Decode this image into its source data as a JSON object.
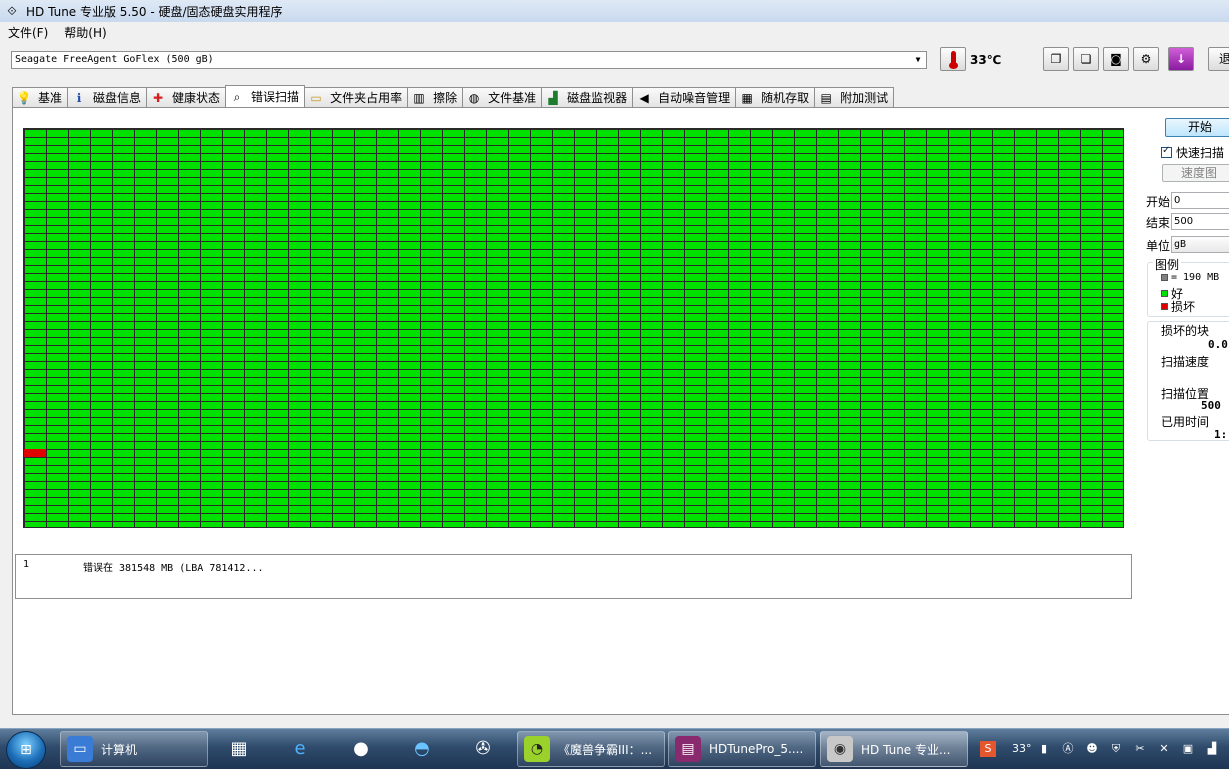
{
  "window": {
    "title": "HD Tune 专业版 5.50 - 硬盘/固态硬盘实用程序"
  },
  "menu": [
    {
      "label": "文件(F)"
    },
    {
      "label": "帮助(H)"
    }
  ],
  "drive": {
    "selected": "Seagate FreeAgent GoFlex (500 gB)"
  },
  "temperature": "33℃",
  "toolbar": {
    "exit_label": "退"
  },
  "icons": {
    "app": "hd-tune-icon",
    "thermometer": "thermometer-icon",
    "copy_text": "copy-text-icon",
    "copy_screen": "copy-screen-icon",
    "camera": "camera-icon",
    "options": "options-icon",
    "save": "download-icon"
  },
  "tabs": [
    {
      "label": "基准",
      "icon": "lightbulb-icon"
    },
    {
      "label": "磁盘信息",
      "icon": "info-icon"
    },
    {
      "label": "健康状态",
      "icon": "health-cross-icon"
    },
    {
      "label": "错误扫描",
      "icon": "magnifier-icon",
      "active": true
    },
    {
      "label": "文件夹占用率",
      "icon": "folder-icon"
    },
    {
      "label": "擦除",
      "icon": "trash-icon"
    },
    {
      "label": "文件基准",
      "icon": "file-bench-icon"
    },
    {
      "label": "磁盘监视器",
      "icon": "monitor-chart-icon"
    },
    {
      "label": "自动噪音管理",
      "icon": "speaker-icon"
    },
    {
      "label": "随机存取",
      "icon": "random-access-icon"
    },
    {
      "label": "附加测试",
      "icon": "extra-tests-icon"
    }
  ],
  "scan_grid": {
    "columns": 50,
    "rows": 50,
    "colors": {
      "good": "#00e100",
      "bad": "#e00000",
      "grid": "#2a2a2a"
    },
    "bad_blocks": [
      {
        "col": 0,
        "row": 40
      }
    ]
  },
  "log": [
    {
      "index": "1",
      "message": "错误在 381548 MB (LBA 781412..."
    }
  ],
  "controls": {
    "start_label": "开始",
    "quick_scan_label": "快速扫描",
    "quick_scan_checked": true,
    "speed_map_label": "速度图",
    "start_field_label": "开始",
    "start_value": "0",
    "end_field_label": "结束",
    "end_value": "500",
    "unit_field_label": "单位",
    "unit_value": "gB"
  },
  "legend": {
    "title": "图例",
    "block_size": "= 190 MB",
    "good_label": "好",
    "bad_label": "损坏",
    "colors": {
      "block": "#808080",
      "good": "#00e100",
      "bad": "#e00000"
    }
  },
  "stats": {
    "damaged_label": "损坏的块",
    "damaged_value": "0.0",
    "speed_label": "扫描速度",
    "position_label": "扫描位置",
    "position_value": "500",
    "elapsed_label": "已用时间",
    "elapsed_value": "1:"
  },
  "taskbar": {
    "items": [
      {
        "label": "计算机",
        "icon": "computer-icon"
      },
      {
        "label": "《魔兽争霸III：...",
        "icon": "pacman-icon"
      },
      {
        "label": "HDTunePro_5....",
        "icon": "winrar-icon"
      },
      {
        "label": "HD Tune 专业...",
        "icon": "hd-tune-icon",
        "active": true
      }
    ],
    "pinned": [
      "calculator-icon",
      "ie-icon",
      "qq-icon",
      "dolphin-icon",
      "media-player-icon"
    ],
    "tray": {
      "temperature": "33°",
      "icons": [
        "sogou-icon",
        "usb-icon",
        "a-icon",
        "network-user-icon",
        "shield-icon",
        "tools-icon",
        "safe-remove-icon",
        "battery-icon",
        "signal-icon"
      ]
    }
  }
}
